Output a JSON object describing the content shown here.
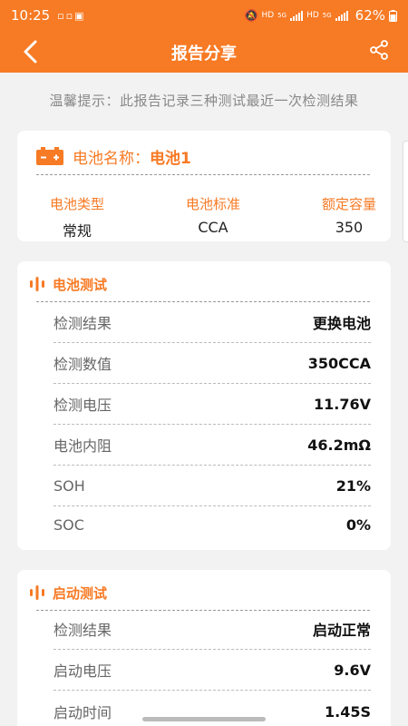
{
  "status": {
    "time": "10:25",
    "net1": "HD",
    "net1_gen": "5G",
    "net2": "HD",
    "net2_gen": "5G",
    "battery": "62%"
  },
  "navbar": {
    "title": "报告分享"
  },
  "tip": "温馨提示：此报告记录三种测试最近一次检测结果",
  "battery_card": {
    "name_label": "电池名称：",
    "name_value": "电池1",
    "info": [
      {
        "label": "电池类型",
        "value": "常规"
      },
      {
        "label": "电池标准",
        "value": "CCA"
      },
      {
        "label": "额定容量",
        "value": "350"
      }
    ]
  },
  "battery_test": {
    "title": "电池测试",
    "rows": [
      {
        "key": "检测结果",
        "value": "更换电池"
      },
      {
        "key": "检测数值",
        "value": "350CCA"
      },
      {
        "key": "检测电压",
        "value": "11.76V"
      },
      {
        "key": "电池内阻",
        "value": "46.2mΩ"
      },
      {
        "key": "SOH",
        "value": "21%"
      },
      {
        "key": "SOC",
        "value": "0%"
      }
    ]
  },
  "start_test": {
    "title": "启动测试",
    "rows": [
      {
        "key": "检测结果",
        "value": "启动正常"
      },
      {
        "key": "启动电压",
        "value": "9.6V"
      },
      {
        "key": "启动时间",
        "value": "1.45S"
      }
    ]
  },
  "colors": {
    "accent": "#f77a24",
    "background": "#f2f2f2"
  }
}
